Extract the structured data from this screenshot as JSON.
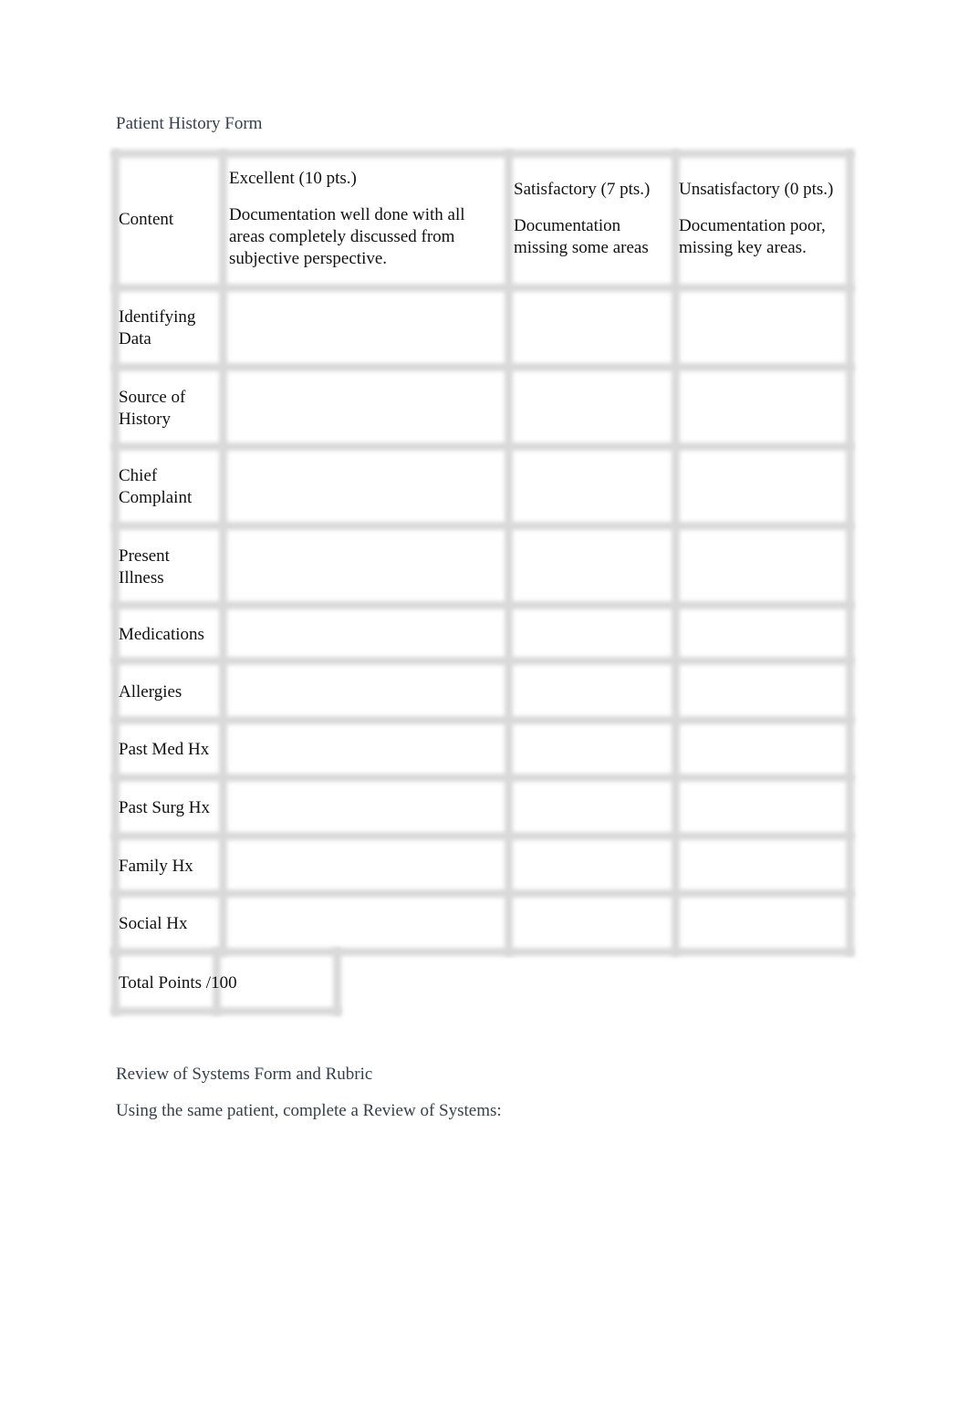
{
  "section1": {
    "title": "Patient History Form",
    "table": {
      "header": {
        "content_label": "Content",
        "columns": [
          {
            "title": "Excellent (10 pts.)",
            "description": "Documentation well done with all areas completely discussed from subjective perspective."
          },
          {
            "title": "Satisfactory (7 pts.)",
            "description": "Documentation missing some areas"
          },
          {
            "title": "Unsatisfactory (0 pts.)",
            "description": "Documentation poor, missing key areas."
          }
        ]
      },
      "rows": [
        {
          "label": "Identifying Data",
          "excellent": "",
          "satisfactory": "",
          "unsatisfactory": ""
        },
        {
          "label": "Source of History",
          "excellent": "",
          "satisfactory": "",
          "unsatisfactory": ""
        },
        {
          "label": "Chief Complaint",
          "excellent": "",
          "satisfactory": "",
          "unsatisfactory": ""
        },
        {
          "label": "Present Illness",
          "excellent": "",
          "satisfactory": "",
          "unsatisfactory": ""
        },
        {
          "label": "Medications",
          "excellent": "",
          "satisfactory": "",
          "unsatisfactory": ""
        },
        {
          "label": "Allergies",
          "excellent": "",
          "satisfactory": "",
          "unsatisfactory": ""
        },
        {
          "label": "Past Med Hx",
          "excellent": "",
          "satisfactory": "",
          "unsatisfactory": ""
        },
        {
          "label": "Past Surg Hx",
          "excellent": "",
          "satisfactory": "",
          "unsatisfactory": ""
        },
        {
          "label": "Family Hx",
          "excellent": "",
          "satisfactory": "",
          "unsatisfactory": ""
        },
        {
          "label": "Social Hx",
          "excellent": "",
          "satisfactory": "",
          "unsatisfactory": ""
        }
      ],
      "total": {
        "label": "Total Points /100",
        "value": ""
      }
    }
  },
  "section2": {
    "title": "Review of Systems Form and Rubric",
    "instruction": "Using the same patient, complete a Review of Systems:"
  }
}
